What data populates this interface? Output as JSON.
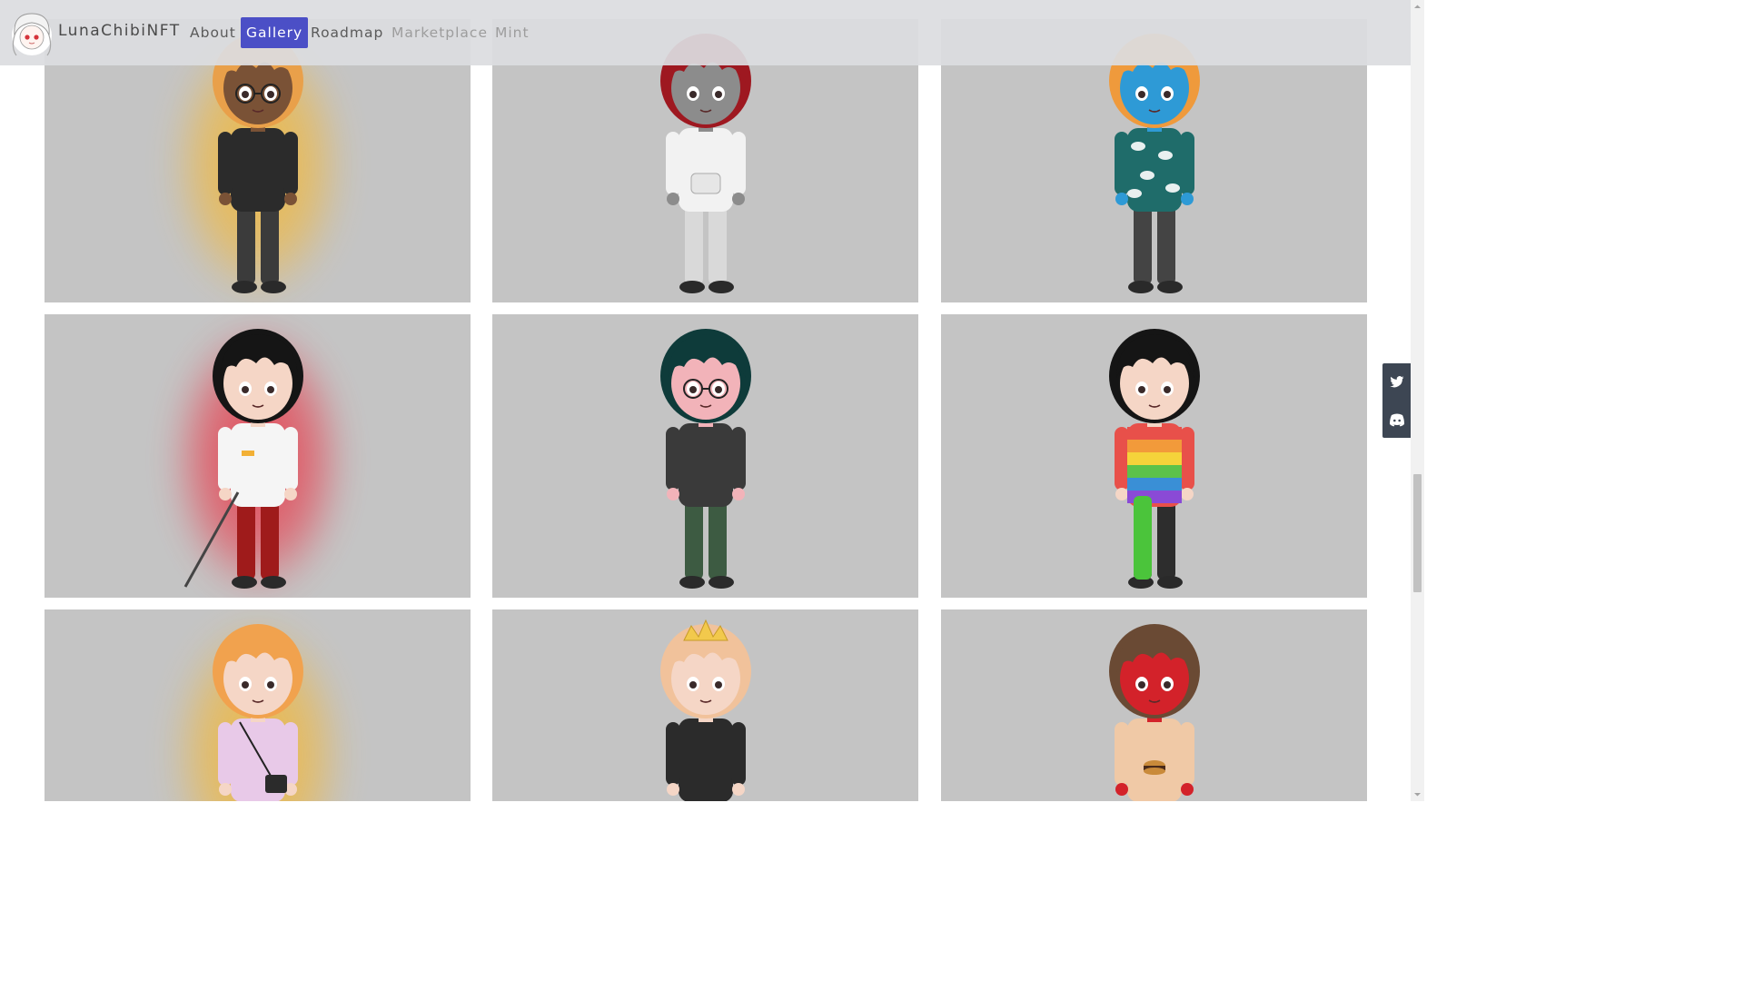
{
  "navbar": {
    "brand": "LunaChibiNFT",
    "items": [
      {
        "label": "About",
        "state": "normal"
      },
      {
        "label": "Gallery",
        "state": "active"
      },
      {
        "label": "Roadmap",
        "state": "normal"
      },
      {
        "label": "Marketplace",
        "state": "disabled"
      },
      {
        "label": "Mint",
        "state": "disabled"
      }
    ],
    "active_color": "#4b4fc6"
  },
  "gallery": {
    "card_background": "#c4c4c4",
    "cards": [
      {
        "name": "card-1",
        "hair": "#e9a04a",
        "skin": "#7a5236",
        "top": "#2b2b2b",
        "bottom": "#3b3b3b",
        "glow": "#f5b731",
        "extra": "glasses"
      },
      {
        "name": "card-2",
        "hair": "#9e1820",
        "skin": "#8c8c8c",
        "top": "#f2f2f2",
        "bottom": "#d9d9d9",
        "glow": "",
        "extra": "hoodie"
      },
      {
        "name": "card-3",
        "hair": "#ef9a3c",
        "skin": "#2e9ad6",
        "top": "#1f6c6a",
        "bottom": "#444444",
        "glow": "",
        "extra": "cloud-shirt"
      },
      {
        "name": "card-4",
        "hair": "#151515",
        "skin": "#f5d6c6",
        "top": "#f5f5f5",
        "bottom": "#9f1b1b",
        "glow": "#ea3344",
        "extra": "sword"
      },
      {
        "name": "card-5",
        "hair": "#0e3b3a",
        "skin": "#f2b3b9",
        "top": "#3a3a3a",
        "bottom": "#3d5b42",
        "glow": "",
        "extra": "glasses"
      },
      {
        "name": "card-6",
        "hair": "#151515",
        "skin": "#f5d6c6",
        "top": "#e8504a",
        "bottom": "#2d2d2d",
        "glow": "",
        "extra": "rainbow"
      },
      {
        "name": "card-7",
        "hair": "#f1a24e",
        "skin": "#f5d6c6",
        "top": "#e8c9e8",
        "bottom": "#333333",
        "glow": "#f5b731",
        "extra": "bag"
      },
      {
        "name": "card-8",
        "hair": "#f1c29b",
        "skin": "#f5d6c6",
        "top": "#2b2b2b",
        "bottom": "#3b3b3b",
        "glow": "",
        "extra": "crown"
      },
      {
        "name": "card-9",
        "hair": "#6a4a34",
        "skin": "#d3222a",
        "top": "#f0c9a6",
        "bottom": "#e8c29a",
        "glow": "",
        "extra": "burger"
      }
    ]
  },
  "social": {
    "items": [
      {
        "name": "twitter",
        "icon": "twitter-icon"
      },
      {
        "name": "discord",
        "icon": "discord-icon"
      }
    ]
  }
}
